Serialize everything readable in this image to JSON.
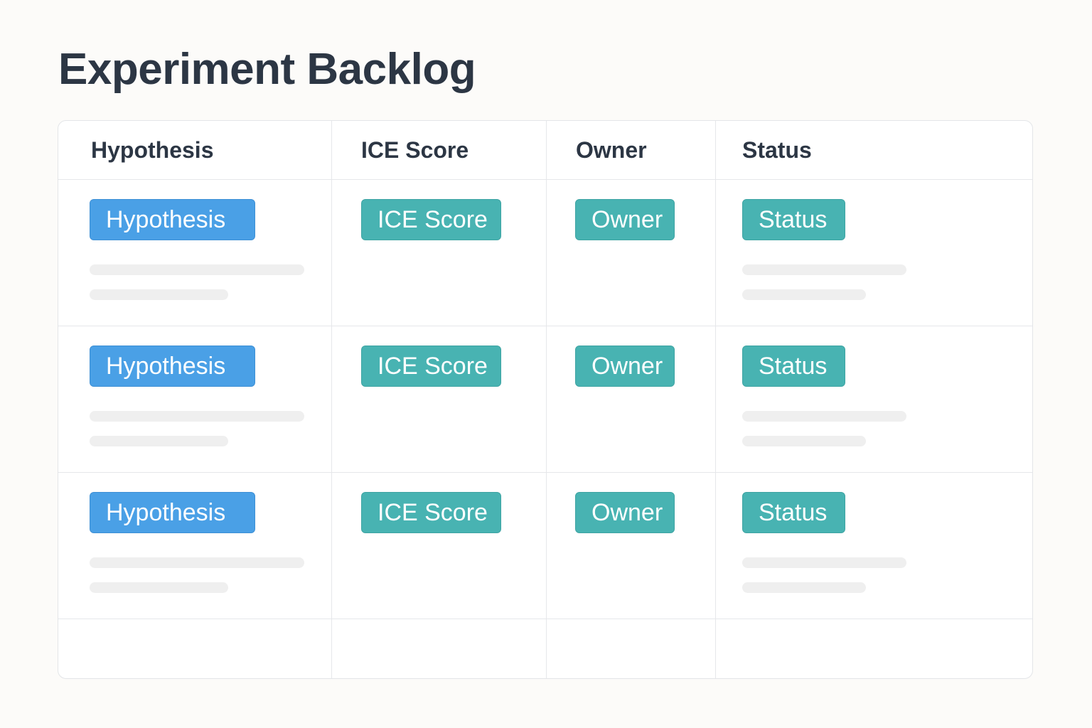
{
  "page": {
    "title": "Experiment Backlog"
  },
  "table": {
    "columns": [
      "Hypothesis",
      "ICE Score",
      "Owner",
      "Status"
    ],
    "rows": [
      {
        "hypothesis": "Hypothesis",
        "ice_score": "ICE Score",
        "owner": "Owner",
        "status": "Status"
      },
      {
        "hypothesis": "Hypothesis",
        "ice_score": "ICE Score",
        "owner": "Owner",
        "status": "Status"
      },
      {
        "hypothesis": "Hypothesis",
        "ice_score": "ICE Score",
        "owner": "Owner",
        "status": "Status"
      }
    ]
  },
  "colors": {
    "title_text": "#2c3644",
    "hypothesis_chip": "#4aa0e6",
    "ice_owner_status_chip": "#48b3b2",
    "skeleton_placeholder": "#efefef",
    "page_background": "#fcfbf9"
  }
}
